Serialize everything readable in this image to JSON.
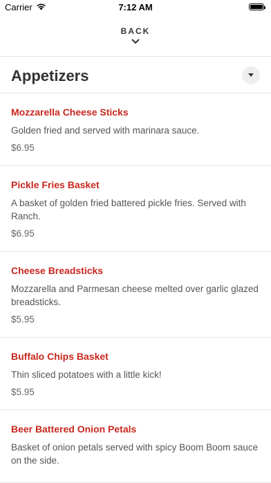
{
  "status_bar": {
    "carrier": "Carrier",
    "time": "7:12 AM"
  },
  "nav": {
    "back_label": "BACK"
  },
  "section": {
    "title": "Appetizers"
  },
  "items": [
    {
      "name": "Mozzarella Cheese Sticks",
      "description": "Golden fried and served with marinara sauce.",
      "price": "$6.95"
    },
    {
      "name": "Pickle Fries Basket",
      "description": "A basket of golden fried battered pickle fries. Served with Ranch.",
      "price": "$6.95"
    },
    {
      "name": "Cheese Breadsticks",
      "description": "Mozzarella and Parmesan cheese melted over garlic glazed breadsticks.",
      "price": "$5.95"
    },
    {
      "name": "Buffalo Chips Basket",
      "description": "Thin sliced potatoes with a little kick!",
      "price": "$5.95"
    },
    {
      "name": "Beer Battered Onion Petals",
      "description": "Basket of onion petals served with spicy Boom Boom sauce on the side.",
      "price": ""
    }
  ],
  "colors": {
    "item_name": "#c8271e",
    "divider": "#e6e6e6"
  }
}
